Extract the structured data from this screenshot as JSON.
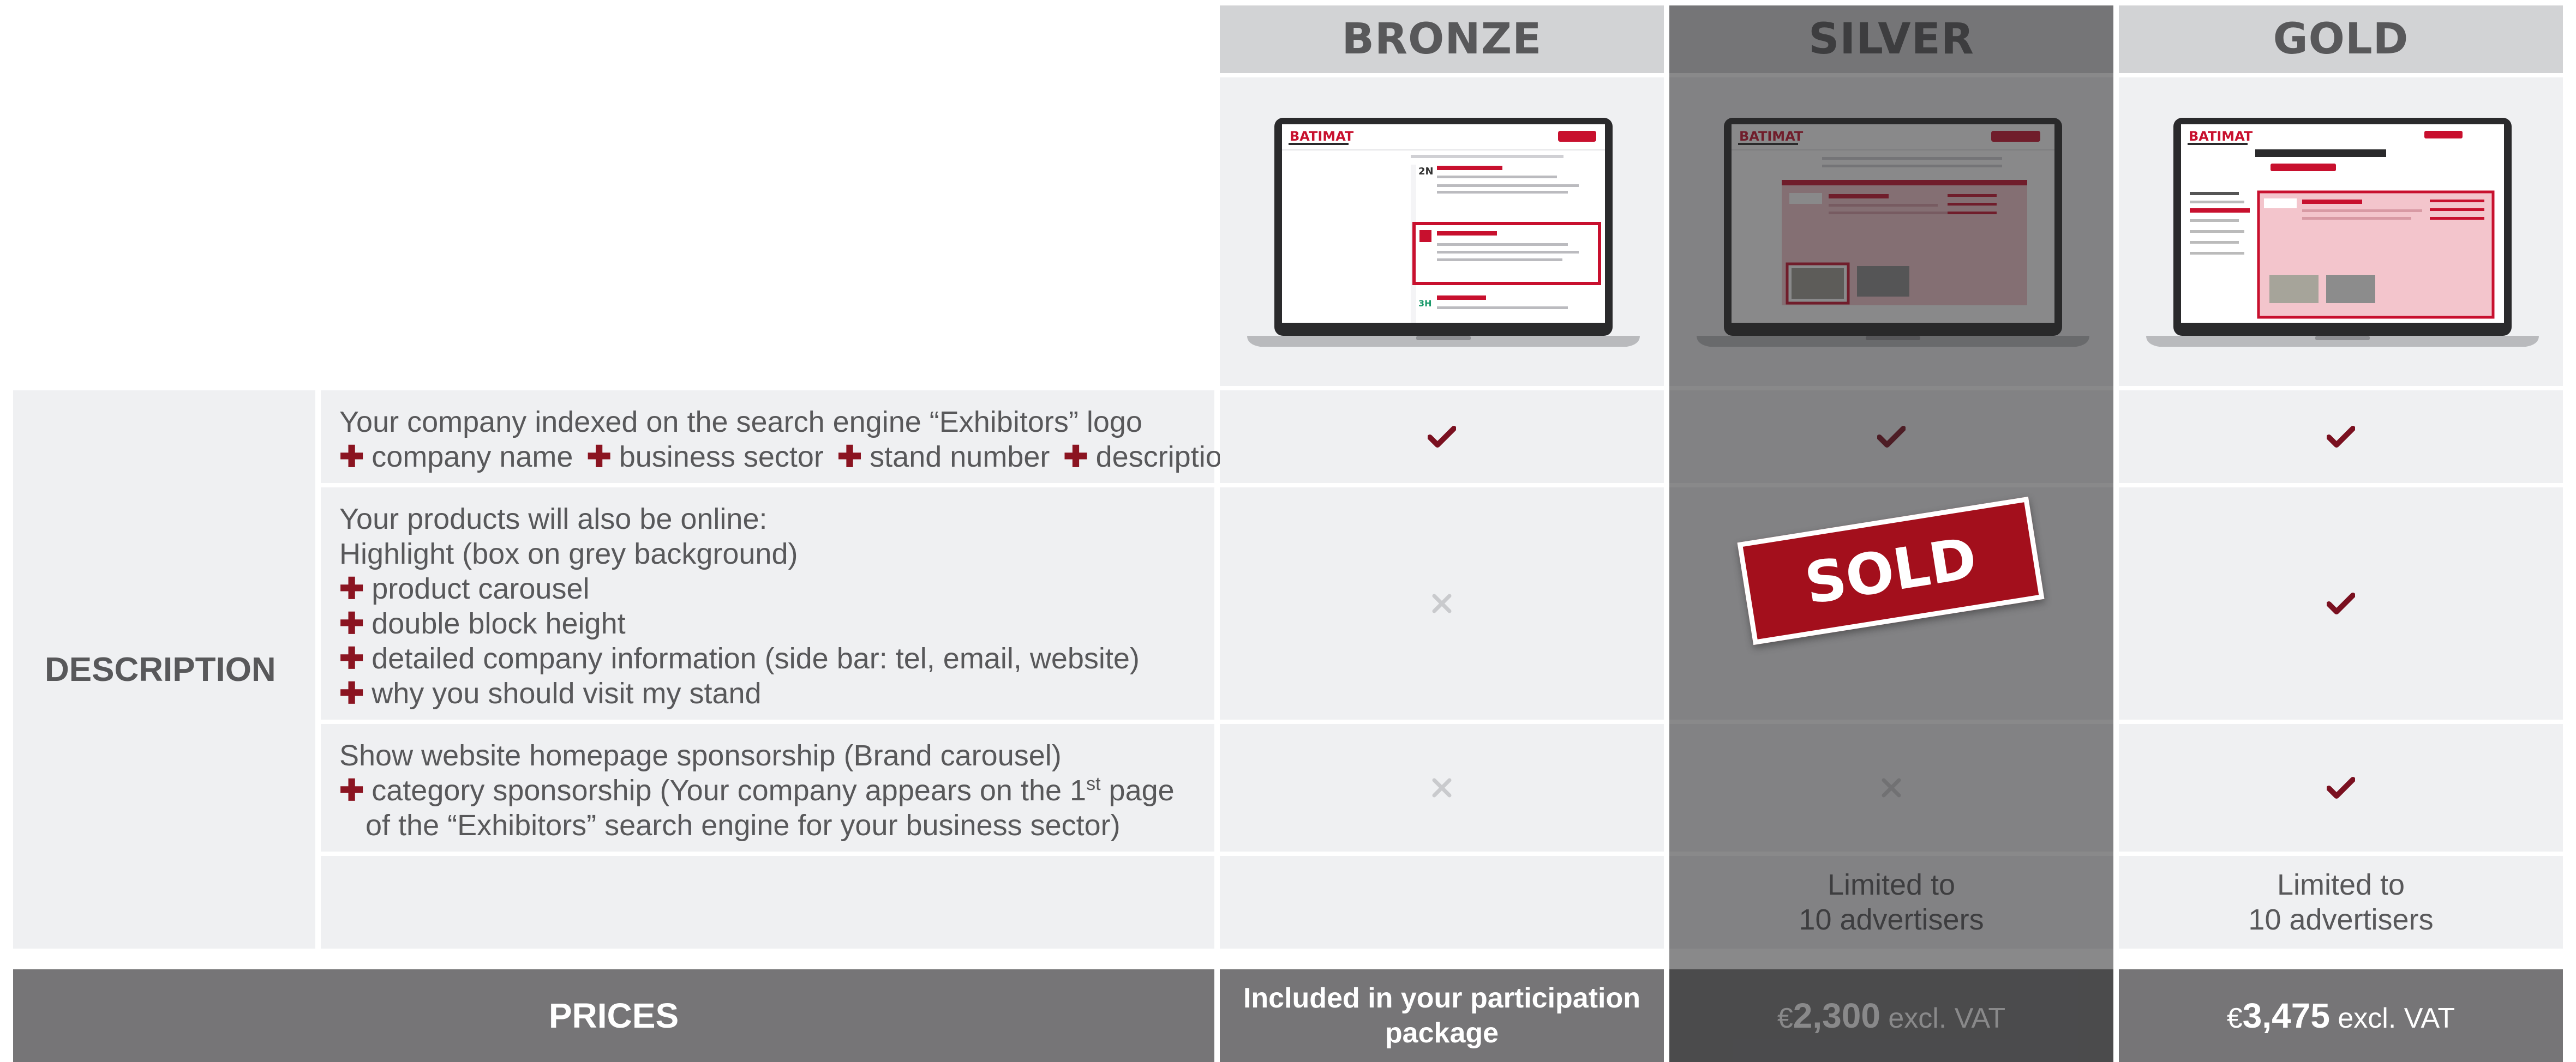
{
  "tiers": [
    {
      "name": "BRONZE",
      "screenshot_logo": "BATIMAT"
    },
    {
      "name": "SILVER",
      "screenshot_logo": "BATIMAT"
    },
    {
      "name": "GOLD",
      "screenshot_logo": "BATIMAT"
    }
  ],
  "description": {
    "label": "DESCRIPTION",
    "rows": [
      {
        "lines": [
          {
            "plus": false,
            "text": "Your company indexed on the search engine “Exhibitors” logo"
          },
          {
            "plus": true,
            "parts": [
              "company name",
              "business sector",
              "stand number",
              "description"
            ]
          }
        ],
        "marks": [
          "check-icon",
          "check-icon",
          "check-icon"
        ]
      },
      {
        "lines": [
          {
            "plus": false,
            "text": "Your products will also be online:"
          },
          {
            "plus": false,
            "text": "Highlight (box on grey background)"
          },
          {
            "plus": true,
            "text": "product carousel"
          },
          {
            "plus": true,
            "text": "double block height"
          },
          {
            "plus": true,
            "text": "detailed company information (side bar: tel, email, website)"
          },
          {
            "plus": true,
            "text": "why you should visit my stand"
          }
        ],
        "marks": [
          "cross-icon",
          "sold-stamp",
          "check-icon"
        ]
      },
      {
        "lines": [
          {
            "plus": false,
            "text": "Show website homepage sponsorship (Brand carousel)"
          },
          {
            "plus": true,
            "text_before_sup": "category sponsorship (Your company appears on the 1",
            "sup": "st",
            "text_after_sup": " page"
          },
          {
            "plus": false,
            "indent": true,
            "text": "of the “Exhibitors” search engine for your business sector)"
          }
        ],
        "marks": [
          "cross-icon",
          "cross-icon",
          "check-icon"
        ]
      },
      {
        "limits": [
          "",
          "Limited to 10 advertisers",
          "Limited to 10 advertisers"
        ],
        "limit_line1": "Limited to",
        "limit_line2": "10 advertisers"
      }
    ]
  },
  "sold_label": "SOLD",
  "prices": {
    "label": "PRICES",
    "bronze": {
      "line1": "Included in your participation",
      "line2": "package"
    },
    "silver": {
      "currency": "€",
      "amount": "2,300",
      "suffix": " excl. VAT"
    },
    "gold": {
      "currency": "€",
      "amount": "3,475",
      "suffix": " excl. VAT"
    }
  },
  "colors": {
    "accent_red": "#8b1421",
    "sold_red": "#a30f1c",
    "header_grey": "#d2d3d5",
    "cell_grey": "#eff0f2",
    "price_bar": "#767577",
    "text_grey": "#58585a"
  }
}
